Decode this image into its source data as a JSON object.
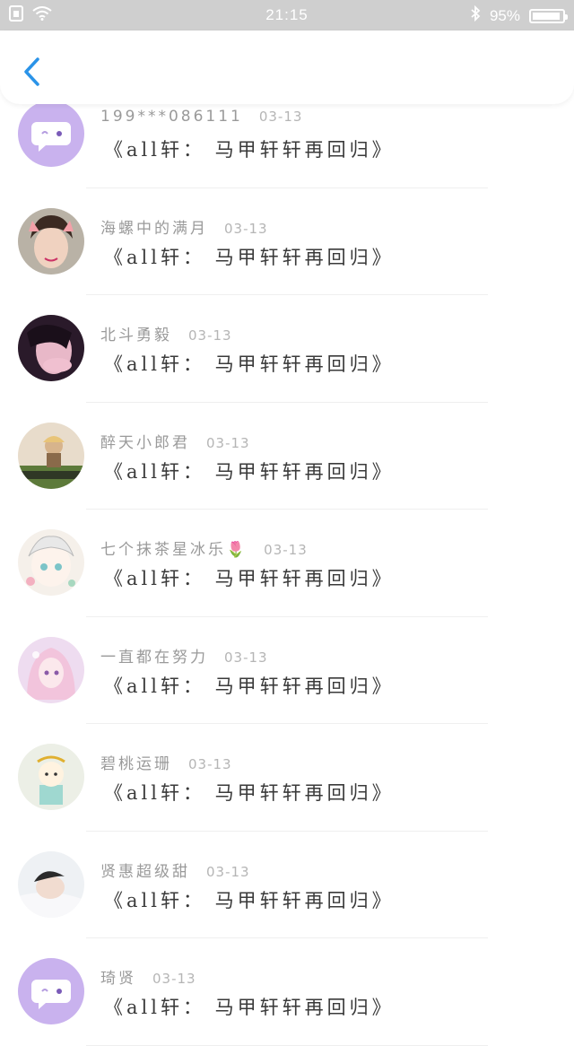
{
  "status_bar": {
    "time": "21:15",
    "battery": "95%",
    "battery_level": 0.95
  },
  "header": {
    "back_icon": "chevron-left-icon"
  },
  "comments": [
    {
      "user": "199***086111",
      "date": "03-13",
      "text": "《all轩： 马甲轩轩再回归》",
      "avatar": "chat-bubble"
    },
    {
      "user": "海螺中的满月",
      "date": "03-13",
      "text": "《all轩： 马甲轩轩再回归》",
      "avatar": "photo-boy"
    },
    {
      "user": "北斗勇毅",
      "date": "03-13",
      "text": "《all轩： 马甲轩轩再回归》",
      "avatar": "photo-dark"
    },
    {
      "user": "醉天小郎君",
      "date": "03-13",
      "text": "《all轩： 马甲轩轩再回归》",
      "avatar": "photo-field"
    },
    {
      "user": "七个抹茶星冰乐🌷",
      "date": "03-13",
      "text": "《all轩： 马甲轩轩再回归》",
      "avatar": "anime-girl"
    },
    {
      "user": "一直都在努力",
      "date": "03-13",
      "text": "《all轩： 马甲轩轩再回归》",
      "avatar": "anime-pink"
    },
    {
      "user": "碧桃运珊",
      "date": "03-13",
      "text": "《all轩： 马甲轩轩再回归》",
      "avatar": "cartoon-boy"
    },
    {
      "user": "贤惠超级甜",
      "date": "03-13",
      "text": "《all轩： 马甲轩轩再回归》",
      "avatar": "photo-sleep"
    },
    {
      "user": "琦贤",
      "date": "03-13",
      "text": "《all轩： 马甲轩轩再回归》",
      "avatar": "chat-bubble"
    }
  ],
  "colors": {
    "accent": "#2a93e8",
    "bubble": "#c9b2ee"
  }
}
